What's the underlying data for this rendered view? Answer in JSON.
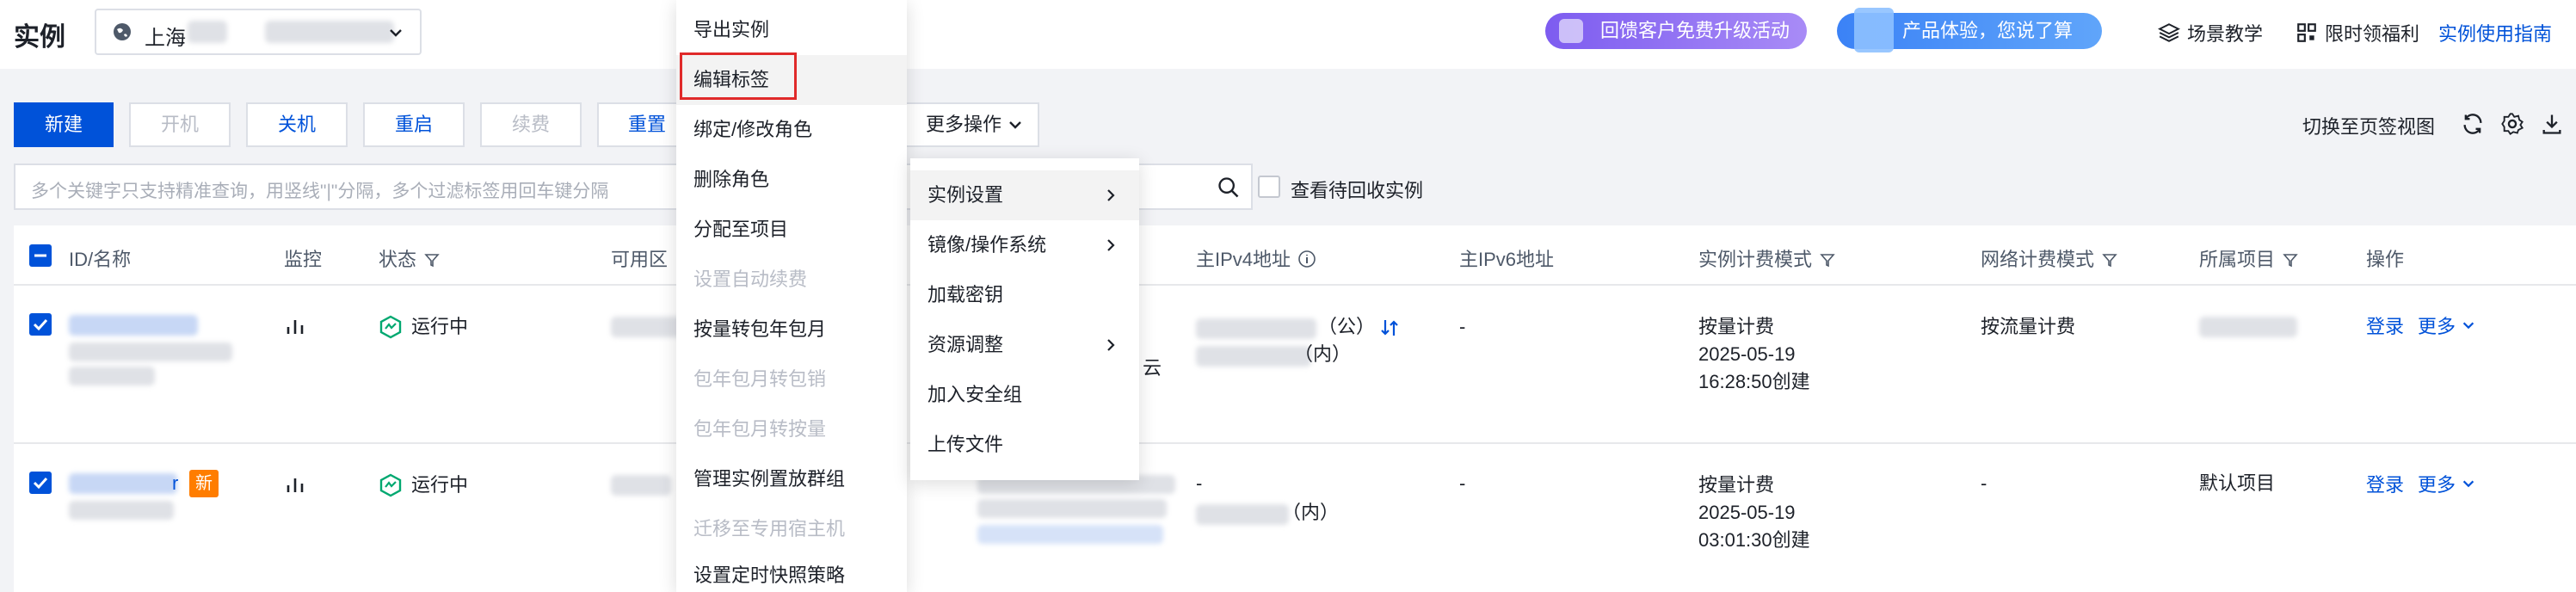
{
  "page_title": "实例",
  "region": {
    "label": "上海"
  },
  "header": {
    "promo1": "回馈客户免费升级活动",
    "promo2": "产品体验，您说了算",
    "links": [
      "场景教学",
      "限时领福利",
      "实例使用指南"
    ]
  },
  "toolbar": {
    "new": "新建",
    "start": "开机",
    "shutdown": "关机",
    "restart": "重启",
    "renew": "续费",
    "reset": "重置密",
    "more_ops": "更多操作",
    "switch_view": "切换至页签视图"
  },
  "search": {
    "placeholder": "多个关键字只支持精准查询，用竖线\"|\"分隔，多个过滤标签用回车键分隔",
    "recycle_label": "查看待回收实例"
  },
  "table": {
    "headers": {
      "id": "ID/名称",
      "monitor": "监控",
      "status": "状态",
      "zone": "可用区",
      "ipv4": "主IPv4地址",
      "ipv6": "主IPv6地址",
      "billing": "实例计费模式",
      "net_billing": "网络计费模式",
      "project": "所属项目",
      "actions": "操作"
    },
    "rows": [
      {
        "status": "运行中",
        "zone_tail": "云",
        "ipv4_pub": "（公）",
        "ipv4_priv": "（内）",
        "ipv6": "-",
        "billing_mode": "按量计费",
        "created_date": "2025-05-19",
        "created_time": "16:28:50创建",
        "net_billing": "按流量计费",
        "login": "登录",
        "more": "更多"
      },
      {
        "status": "运行中",
        "new_badge": "新",
        "id_suffix": "r",
        "ipv4_dash": "-",
        "ipv4_priv": "（内）",
        "ipv6": "-",
        "billing_mode": "按量计费",
        "created_date": "2025-05-19",
        "created_time": "03:01:30创建",
        "net_billing": "-",
        "project": "默认项目",
        "login": "登录",
        "more": "更多"
      }
    ]
  },
  "more_menu": {
    "items": [
      {
        "label": "导出实例",
        "disabled": false
      },
      {
        "label": "编辑标签",
        "disabled": false
      },
      {
        "label": "绑定/修改角色",
        "disabled": false
      },
      {
        "label": "删除角色",
        "disabled": false
      },
      {
        "label": "分配至项目",
        "disabled": false
      },
      {
        "label": "设置自动续费",
        "disabled": true
      },
      {
        "label": "按量转包年包月",
        "disabled": false
      },
      {
        "label": "包年包月转包销",
        "disabled": true
      },
      {
        "label": "包年包月转按量",
        "disabled": true
      },
      {
        "label": "管理实例置放群组",
        "disabled": false
      },
      {
        "label": "迁移至专用宿主机",
        "disabled": true
      },
      {
        "label": "设置定时快照策略",
        "disabled": false
      }
    ]
  },
  "sub_menu": {
    "items": [
      {
        "label": "实例设置",
        "has_children": true
      },
      {
        "label": "镜像/操作系统",
        "has_children": true
      },
      {
        "label": "加载密钥",
        "has_children": false
      },
      {
        "label": "资源调整",
        "has_children": true
      },
      {
        "label": "加入安全组",
        "has_children": false
      },
      {
        "label": "上传文件",
        "has_children": false
      }
    ]
  },
  "colors": {
    "accent": "#0052d9",
    "status_green": "#00a870",
    "badge_orange": "#ff7d00",
    "highlight_red": "#e02a2a"
  }
}
